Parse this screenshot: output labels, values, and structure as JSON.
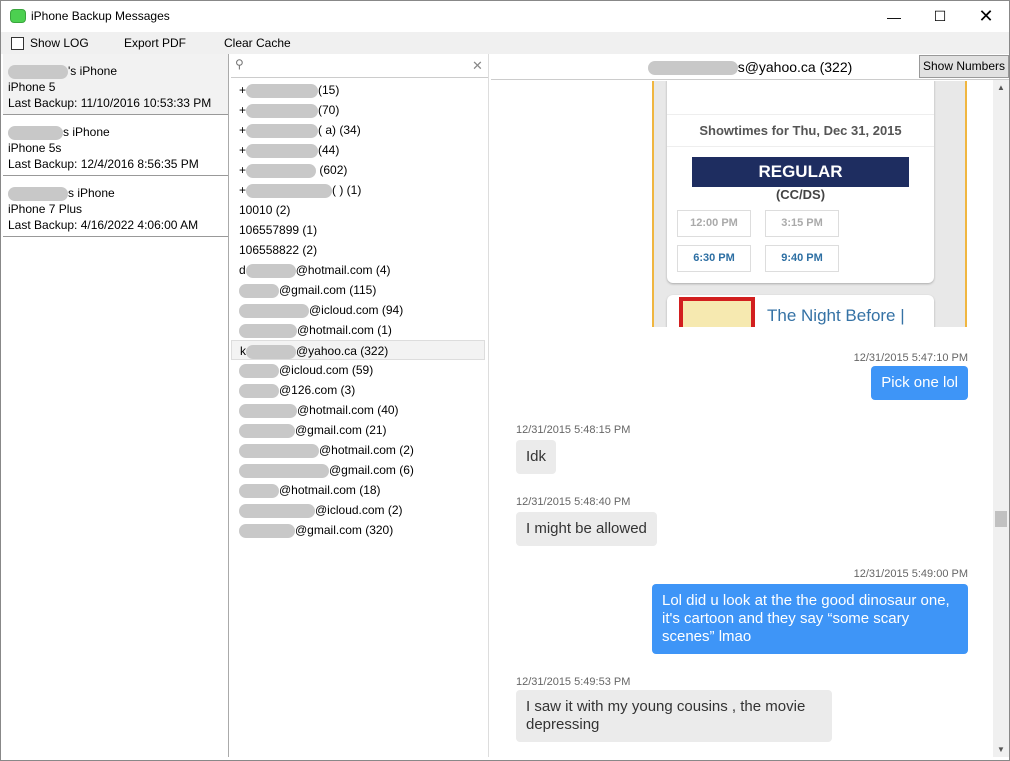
{
  "window": {
    "title": "iPhone Backup Messages"
  },
  "toolbar": {
    "show_log": "Show LOG",
    "export_pdf": "Export PDF",
    "clear_cache": "Clear Cache"
  },
  "devices": [
    {
      "name": "'s iPhone",
      "model": "iPhone 5",
      "backup": "Last Backup: 11/10/2016 10:53:33 PM"
    },
    {
      "name": "s iPhone",
      "model": "iPhone 5s",
      "backup": "Last Backup: 12/4/2016 8:56:35 PM"
    },
    {
      "name": "s iPhone",
      "model": "iPhone 7 Plus",
      "backup": "Last Backup: 4/16/2022 4:06:00 AM"
    }
  ],
  "contacts": [
    {
      "pre": "+",
      "post": "(15)"
    },
    {
      "pre": "+",
      "post": "(70)"
    },
    {
      "pre": "+",
      "post": "(        a) (34)"
    },
    {
      "pre": "+",
      "post": "(44)"
    },
    {
      "pre": "+",
      "post": " (602)"
    },
    {
      "pre": "+",
      "post": "(     ) (1)"
    },
    {
      "pre": "10010 (2)",
      "post": ""
    },
    {
      "pre": "106557899 (1)",
      "post": ""
    },
    {
      "pre": "106558822 (2)",
      "post": ""
    },
    {
      "pre": "d",
      "post": "@hotmail.com (4)"
    },
    {
      "pre": "",
      "post": "@gmail.com (115)"
    },
    {
      "pre": "",
      "post": "@icloud.com (94)"
    },
    {
      "pre": "",
      "post": "@hotmail.com (1)"
    },
    {
      "pre": "k",
      "post": "@yahoo.ca (322)",
      "selected": true
    },
    {
      "pre": "",
      "post": "@icloud.com (59)"
    },
    {
      "pre": "",
      "post": "@126.com (3)"
    },
    {
      "pre": "",
      "post": "@hotmail.com (40)"
    },
    {
      "pre": "",
      "post": "@gmail.com (21)"
    },
    {
      "pre": "",
      "post": "@hotmail.com (2)"
    },
    {
      "pre": "",
      "post": "@gmail.com (6)"
    },
    {
      "pre": "",
      "post": "@hotmail.com (18)"
    },
    {
      "pre": "",
      "post": "@icloud.com (2)"
    },
    {
      "pre": "",
      "post": "@gmail.com (320)"
    }
  ],
  "chat": {
    "title_suffix": "s@yahoo.ca (322)",
    "show_numbers": "Show Numbers",
    "image": {
      "heading": "Showtimes for Thu, Dec 31, 2015",
      "format": "REGULAR",
      "sub": "(CC/DS)",
      "times_past": [
        "12:00 PM",
        "3:15 PM"
      ],
      "times": [
        "6:30 PM",
        "9:40 PM"
      ],
      "movie": "The Night Before |"
    },
    "messages": [
      {
        "ts": "12/31/2015 5:47:10 PM",
        "text": "Pick one lol",
        "dir": "out"
      },
      {
        "ts": "12/31/2015 5:48:15 PM",
        "text": "Idk",
        "dir": "in"
      },
      {
        "ts": "12/31/2015 5:48:40 PM",
        "text": "I might be allowed",
        "dir": "in"
      },
      {
        "ts": "12/31/2015 5:49:00 PM",
        "text": "Lol did u look at the the good dinosaur one, it's cartoon and they say “some scary scenes” lmao",
        "dir": "out"
      },
      {
        "ts": "12/31/2015 5:49:53 PM",
        "text": "I saw it with my young cousins , the movie depressing",
        "dir": "in"
      }
    ]
  }
}
